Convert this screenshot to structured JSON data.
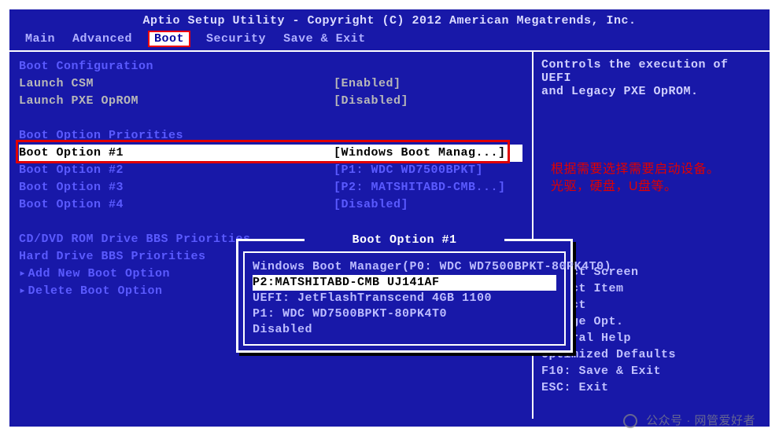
{
  "title": "Aptio Setup Utility - Copyright (C) 2012 American Megatrends, Inc.",
  "tabs": {
    "main": "Main",
    "advanced": "Advanced",
    "boot": "Boot",
    "security": "Security",
    "saveexit": "Save & Exit"
  },
  "left": {
    "heading1": "Boot Configuration",
    "csm_label": "Launch CSM",
    "csm_val": "[Enabled]",
    "pxe_label": " Launch PXE OpROM",
    "pxe_val": "[Disabled]",
    "heading2": "Boot Option Priorities",
    "opt1_label": "Boot Option #1",
    "opt1_val": "[Windows Boot Manag...]",
    "opt2_label": "Boot Option #2",
    "opt2_val": "[P1: WDC WD7500BPKT]",
    "opt3_label": "Boot Option #3",
    "opt3_val": "[P2: MATSHITABD-CMB...]",
    "opt4_label": "Boot Option #4",
    "opt4_val": "[Disabled]",
    "cdrom": " CD/DVD ROM Drive BBS Priorities",
    "hdd": " Hard Drive BBS Priorities",
    "add": "Add New Boot Option",
    "del": "Delete Boot Option"
  },
  "popup": {
    "title": "Boot Option #1",
    "o0": "Windows Boot Manager(P0: WDC WD7500BPKT-80PK4T0)",
    "o1": "P2:MATSHITABD-CMB UJ141AF",
    "o2": "UEFI: JetFlashTranscend 4GB 1100",
    "o3": "P1: WDC WD7500BPKT-80PK4T0",
    "o4": "Disabled"
  },
  "right": {
    "desc1": "Controls the execution of UEFI",
    "desc2": "and Legacy PXE OpROM.",
    "h0": "Select Screen",
    "h1": "Select Item",
    "h2": "Select",
    "h3": "Change Opt.",
    "h4": "General Help",
    "h5": "Optimized Defaults",
    "h6": "F10: Save & Exit",
    "h7": "ESC: Exit"
  },
  "annotation": {
    "l1": "根据需要选择需要启动设备。",
    "l2": "光驱，硬盘，U盘等。"
  },
  "watermark": "公众号 · 网管爱好者"
}
